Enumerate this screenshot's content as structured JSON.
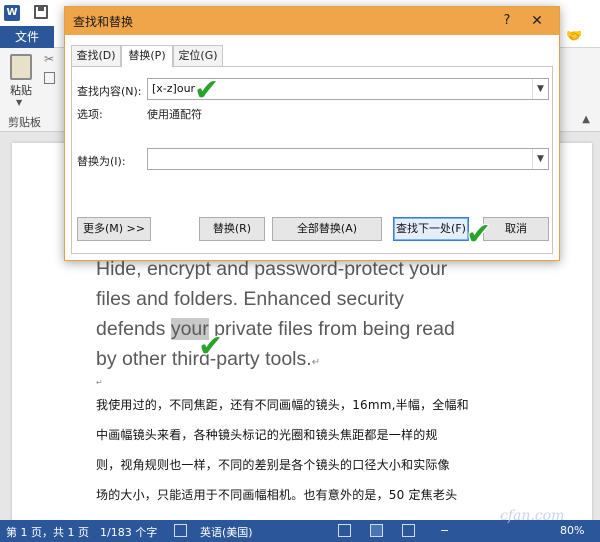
{
  "word": {
    "logo": "W",
    "file_tab": "文件",
    "ribbon": {
      "paste_label": "粘贴",
      "clipboard_group": "剪贴板"
    }
  },
  "dialog": {
    "title": "查找和替换",
    "help": "?",
    "close": "✕",
    "tabs": [
      "查找(D)",
      "替换(P)",
      "定位(G)"
    ],
    "active_tab": "替换(P)",
    "find_label": "查找内容(N):",
    "find_value": "[x-z]our",
    "options_label": "选项:",
    "options_value": "使用通配符",
    "replace_label": "替换为(I):",
    "replace_value": "",
    "buttons": {
      "more": "更多(M) >>",
      "replace": "替换(R)",
      "replace_all": "全部替换(A)",
      "find_next": "查找下一处(F)",
      "cancel": "取消"
    }
  },
  "document": {
    "english_lines": [
      "Hide, encrypt and password-protect your",
      "files and folders. Enhanced security",
      "by other third-party tools."
    ],
    "line3_before": "defends ",
    "line3_highlight": "your",
    "line3_after": " private files from being read",
    "chinese_lines": [
      "我使用过的，不同焦距，还有不同画幅的镜头，16mm,半幅，全幅和",
      "中画幅镜头来看，各种镜头标记的光圈和镜头焦距都是一样的规",
      "则，视角规则也一样，不同的差别是各个镜头的口径大小和实际像",
      "场的大小，只能适用于不同画幅相机。也有意外的是，50 定焦老头"
    ]
  },
  "statusbar": {
    "page": "第 1 页，共 1 页",
    "words": "1/183 个字",
    "language": "英语(美国)",
    "zoom": "80%"
  },
  "watermark": "cfan.com"
}
